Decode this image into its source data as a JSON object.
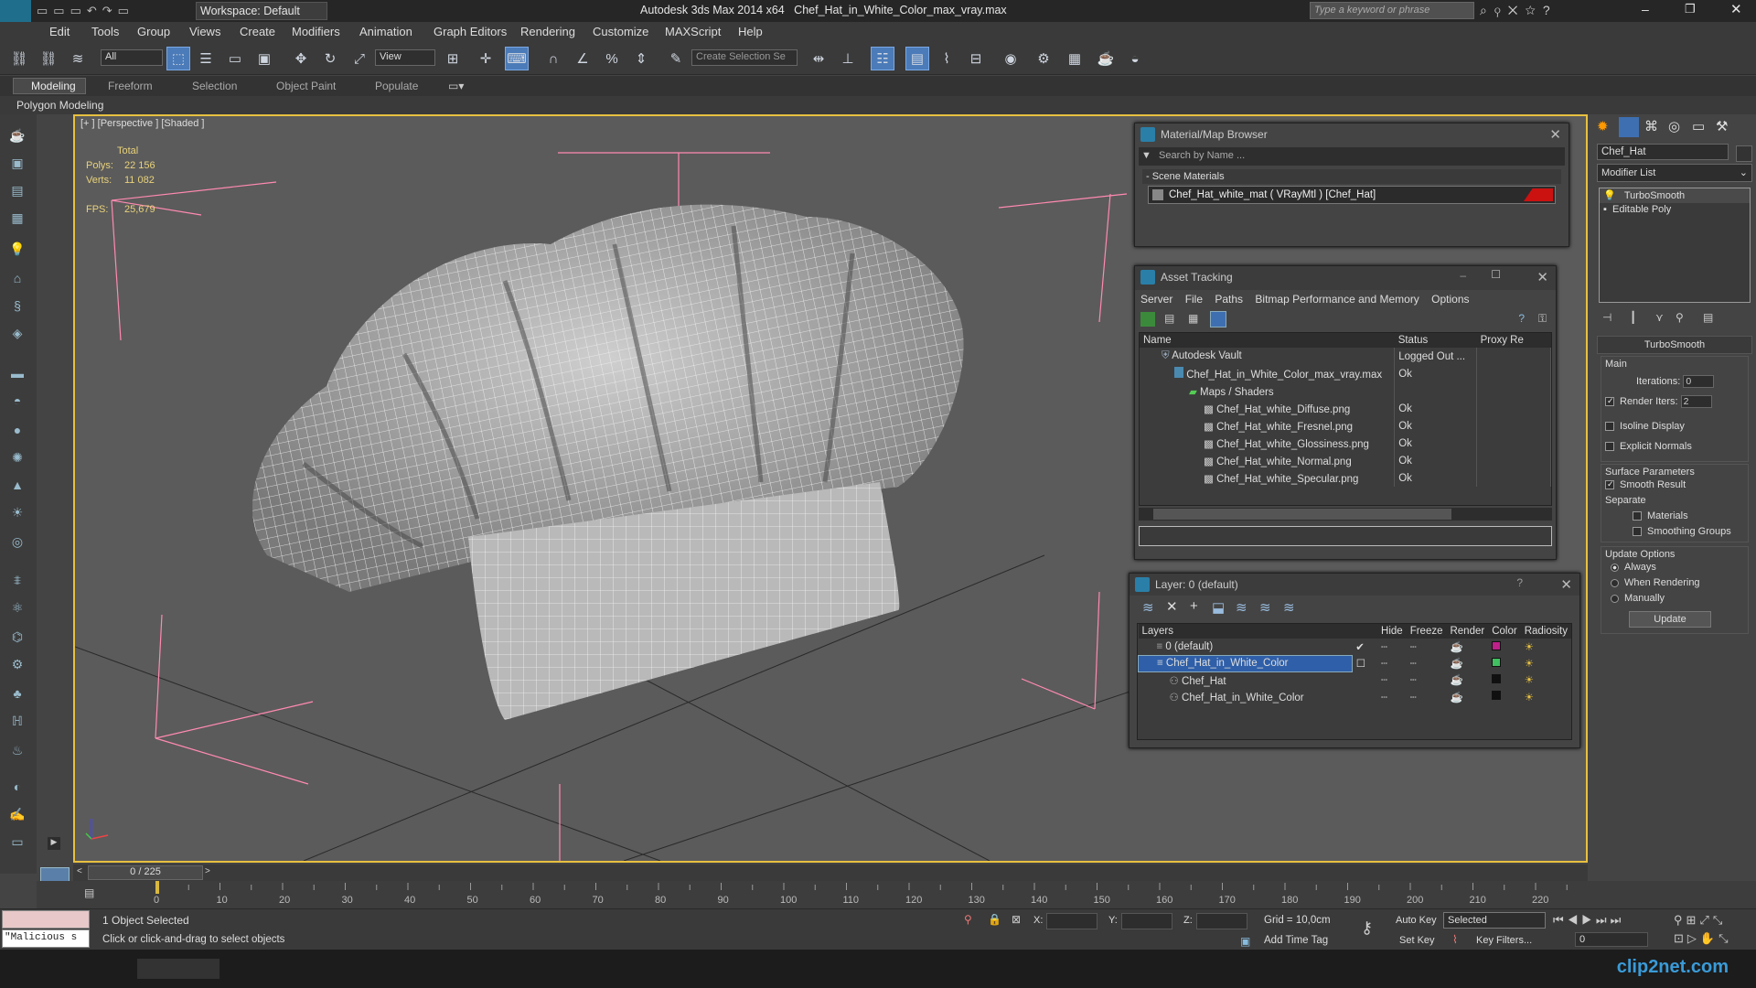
{
  "title": {
    "app": "Autodesk 3ds Max  2014 x64",
    "file": "Chef_Hat_in_White_Color_max_vray.max",
    "workspace": "Workspace: Default",
    "search_placeholder": "Type a keyword or phrase"
  },
  "menu": [
    "Edit",
    "Tools",
    "Group",
    "Views",
    "Create",
    "Modifiers",
    "Animation",
    "Graph Editors",
    "Rendering",
    "Customize",
    "MAXScript",
    "Help"
  ],
  "toolbar": {
    "selection_filter": "All",
    "ref_coord": "View",
    "named_selection": "Create Selection Se"
  },
  "ribbon": {
    "tabs": [
      "Modeling",
      "Freeform",
      "Selection",
      "Object Paint",
      "Populate"
    ],
    "sub": "Polygon Modeling"
  },
  "viewport": {
    "label": "[+ ] [Perspective ] [Shaded ]",
    "stats": {
      "total": "Total",
      "polys_label": "Polys:",
      "polys": "22 156",
      "verts_label": "Verts:",
      "verts": "11 082",
      "fps_label": "FPS:",
      "fps": "25,679"
    }
  },
  "material_browser": {
    "title": "Material/Map Browser",
    "search": "Search by Name ...",
    "group": "- Scene Materials",
    "item": "Chef_Hat_white_mat  ( VRayMtl )  [Chef_Hat]",
    "accent": "#cc1111"
  },
  "asset_tracking": {
    "title": "Asset Tracking",
    "menu": [
      "Server",
      "File",
      "Paths",
      "Bitmap Performance and Memory",
      "Options"
    ],
    "columns": [
      "Name",
      "Status",
      "Proxy Re"
    ],
    "rows": [
      {
        "name": "Autodesk Vault",
        "status": "Logged Out ..."
      },
      {
        "name": "Chef_Hat_in_White_Color_max_vray.max",
        "status": "Ok"
      },
      {
        "name": "Maps / Shaders",
        "status": ""
      },
      {
        "name": "Chef_Hat_white_Diffuse.png",
        "status": "Ok"
      },
      {
        "name": "Chef_Hat_white_Fresnel.png",
        "status": "Ok"
      },
      {
        "name": "Chef_Hat_white_Glossiness.png",
        "status": "Ok"
      },
      {
        "name": "Chef_Hat_white_Normal.png",
        "status": "Ok"
      },
      {
        "name": "Chef_Hat_white_Specular.png",
        "status": "Ok"
      }
    ]
  },
  "layers": {
    "title": "Layer: 0 (default)",
    "columns": [
      "Layers",
      "Hide",
      "Freeze",
      "Render",
      "Color",
      "Radiosity"
    ],
    "rows": [
      {
        "name": "0 (default)",
        "color": "#c0208a"
      },
      {
        "name": "Chef_Hat_in_White_Color",
        "color": "#40c060"
      },
      {
        "name": "Chef_Hat",
        "color": "#101010"
      },
      {
        "name": "Chef_Hat_in_White_Color",
        "color": "#101010"
      }
    ]
  },
  "command_panel": {
    "object_name": "Chef_Hat",
    "modifier_list": "Modifier List",
    "stack": [
      "TurboSmooth",
      "Editable Poly"
    ],
    "turbosmooth": {
      "header": "TurboSmooth",
      "main": "Main",
      "iterations_label": "Iterations:",
      "iterations": "0",
      "render_iters_label": "Render Iters:",
      "render_iters": "2",
      "isoline": "Isoline Display",
      "explicit": "Explicit Normals",
      "surface": "Surface Parameters",
      "smooth_result": "Smooth Result",
      "separate": "Separate",
      "materials": "Materials",
      "smoothing_groups": "Smoothing Groups",
      "update_options": "Update Options",
      "always": "Always",
      "when_rendering": "When Rendering",
      "manually": "Manually",
      "update": "Update"
    }
  },
  "timeline": {
    "frame": "0 / 225",
    "ticks": [
      "0",
      "10",
      "20",
      "30",
      "40",
      "50",
      "60",
      "70",
      "80",
      "90",
      "100",
      "110",
      "120",
      "130",
      "140",
      "150",
      "160",
      "170",
      "180",
      "190",
      "200",
      "210",
      "220"
    ]
  },
  "status": {
    "selected": "1 Object Selected",
    "prompt": "Click or click-and-drag to select objects",
    "maxscript": "\"Malicious s",
    "x": "X:",
    "y": "Y:",
    "z": "Z:",
    "grid": "Grid = 10,0cm",
    "autokey": "Auto Key",
    "setkey": "Set Key",
    "key_mode": "Selected",
    "key_filters": "Key Filters...",
    "add_time_tag": "Add Time Tag",
    "frame": "0"
  },
  "watermark": "clip2net.com"
}
